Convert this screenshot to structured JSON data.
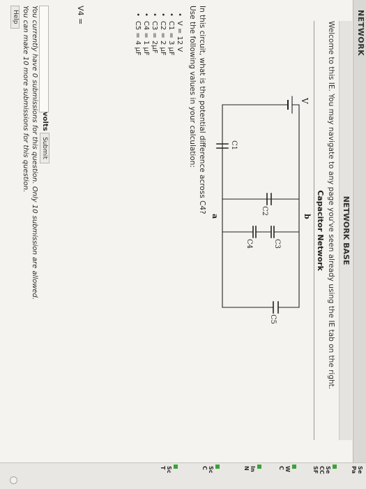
{
  "window": {
    "title": "NETWORK BASE",
    "top_label": "NETWORK"
  },
  "page": {
    "welcome": "Welcome to this IE. You may navigate to any page you've seen already using the IE tab on the right.",
    "subtitle": "Capacitor Network"
  },
  "circuit": {
    "labels": {
      "v": "V",
      "a": "a",
      "b": "b",
      "c1": "C1",
      "c2": "C2",
      "c3": "C3",
      "c4": "C4",
      "c5": "C5"
    }
  },
  "question": {
    "line1": "In this circuit, what is the potential difference across C4?",
    "line2": "Use the following values in your calculation:",
    "values": [
      "V = 12 V",
      "C1 = 3 μF",
      "C2 = 2 μF",
      "C3 = 2μF",
      "C4 = 1 μF",
      "C5 = 4 μF"
    ]
  },
  "answer": {
    "label": "V4 =",
    "input_value": "",
    "units": "volts",
    "submit_label": "Submit"
  },
  "notes": {
    "line1": "You currently have 0 submissions for this question. Only 10 submission are allowed.",
    "line2": "You can make 10 more submissions for this question."
  },
  "help_label": "Help",
  "sidebar": {
    "items": [
      "Se",
      "Pa",
      "Se",
      "CC",
      "SF",
      "W",
      "C",
      "In",
      "N",
      "Sc",
      "C",
      "Sc",
      "T"
    ],
    "mark_color": "#3aa335"
  }
}
